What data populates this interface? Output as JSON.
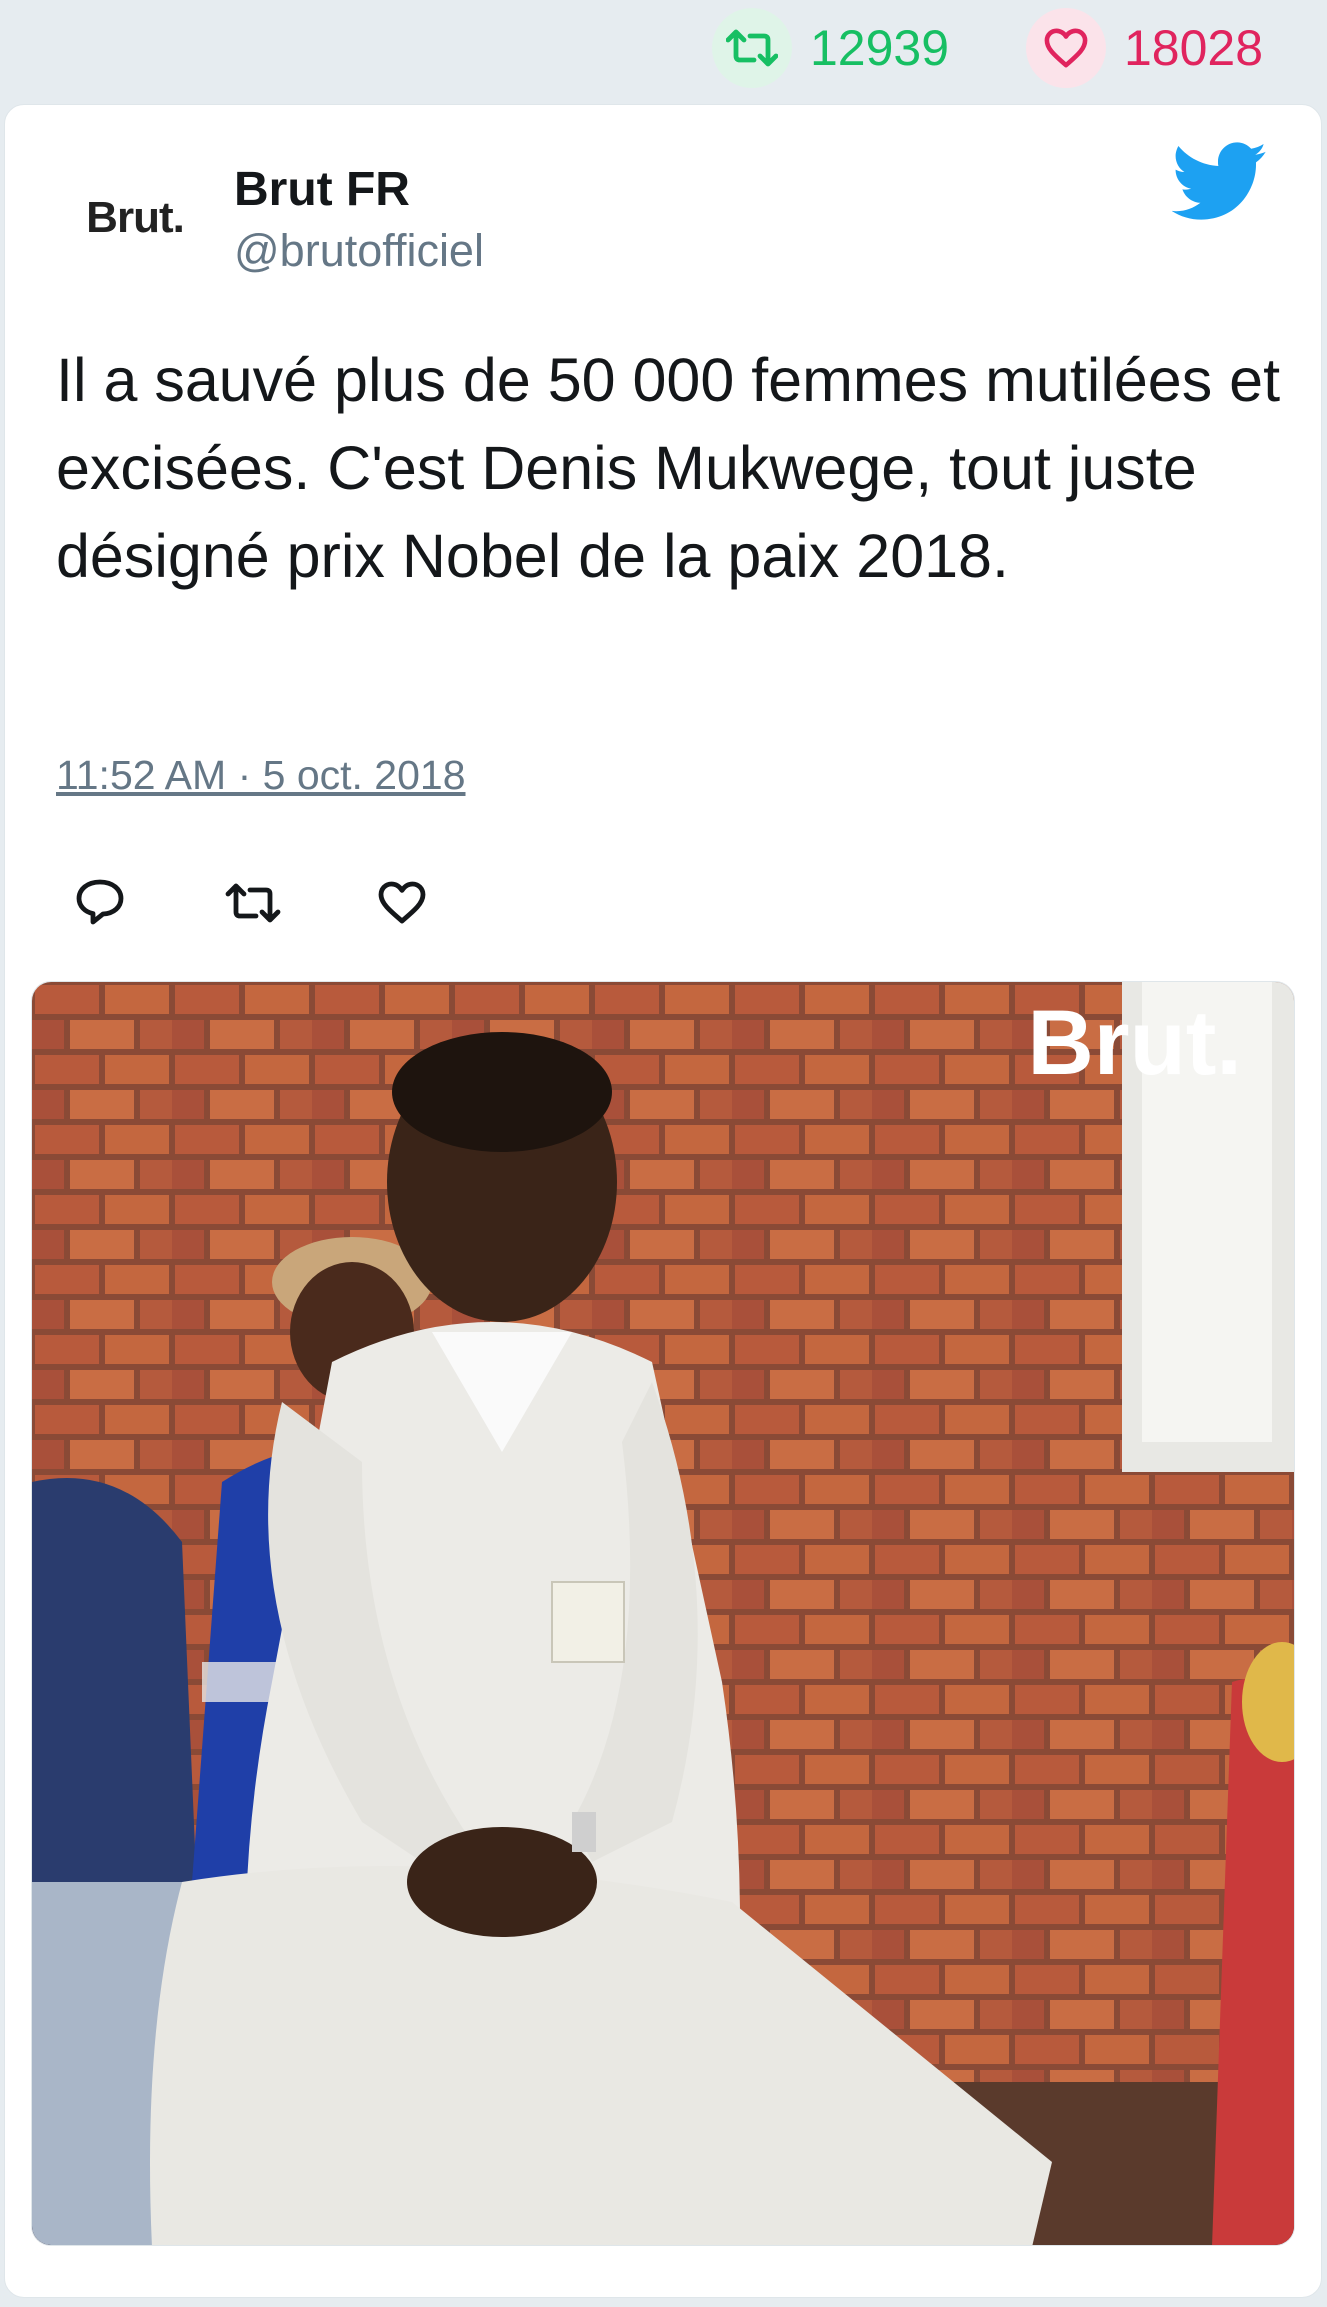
{
  "stats": {
    "retweet_count": "12939",
    "like_count": "18028",
    "retweet_icon": "retweet-icon",
    "like_icon": "heart-icon"
  },
  "tweet": {
    "author_name": "Brut FR",
    "author_handle": "@brutofficiel",
    "avatar_text": "Brut.",
    "text": "Il a sauvé plus de 50 000 femmes mutilées et excisées. C'est Denis Mukwege, tout juste désigné prix Nobel de la paix 2018.",
    "timestamp": "11:52 AM · 5 oct. 2018",
    "media_watermark": "Brut."
  },
  "actions": [
    {
      "name": "reply",
      "icon": "speech-bubble-icon"
    },
    {
      "name": "retweet",
      "icon": "retweet-icon"
    },
    {
      "name": "like",
      "icon": "heart-icon"
    }
  ],
  "colors": {
    "retweet_green": "#17bf63",
    "like_red": "#e0245e",
    "twitter_blue": "#1da1f2",
    "text_primary": "#14171a",
    "text_secondary": "#657786",
    "background": "#e6ecf0"
  }
}
